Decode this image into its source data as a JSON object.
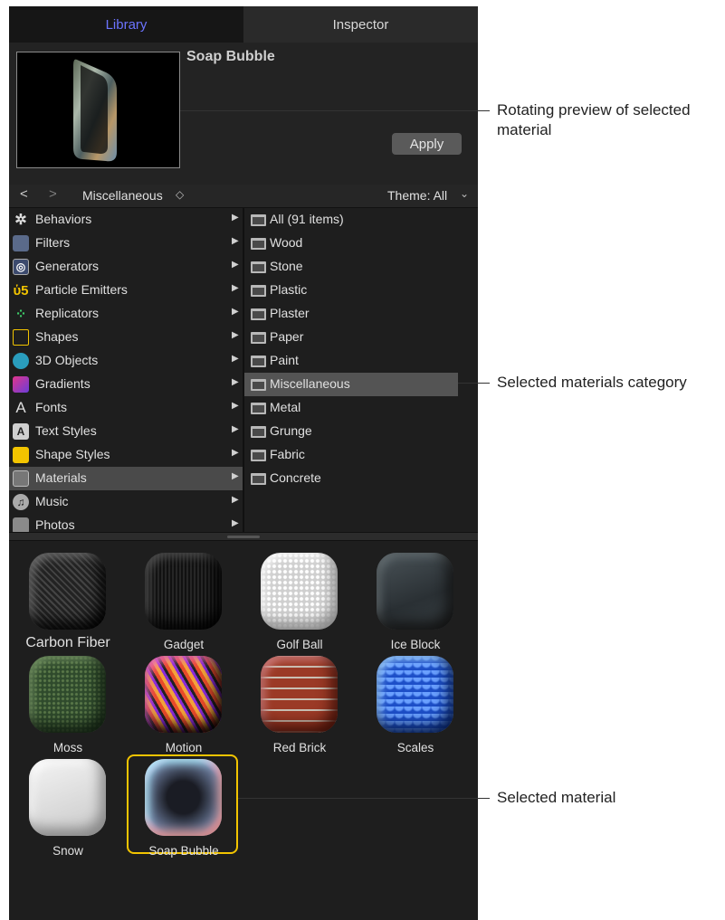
{
  "tabs": {
    "library": "Library",
    "inspector": "Inspector"
  },
  "preview": {
    "title": "Soap Bubble",
    "apply_label": "Apply"
  },
  "navbar": {
    "back": "<",
    "forward": ">",
    "path": "Miscellaneous",
    "path_arrows": "◇",
    "theme": "Theme: All",
    "theme_chevron": "⌄"
  },
  "categories": [
    {
      "label": "Behaviors",
      "icon": "gear-icon"
    },
    {
      "label": "Filters",
      "icon": "filmstrip-icon"
    },
    {
      "label": "Generators",
      "icon": "generator-icon"
    },
    {
      "label": "Particle Emitters",
      "icon": "particle-emitter-icon"
    },
    {
      "label": "Replicators",
      "icon": "replicator-icon"
    },
    {
      "label": "Shapes",
      "icon": "shape-icon"
    },
    {
      "label": "3D Objects",
      "icon": "cube-icon"
    },
    {
      "label": "Gradients",
      "icon": "gradient-icon"
    },
    {
      "label": "Fonts",
      "icon": "font-icon"
    },
    {
      "label": "Text Styles",
      "icon": "text-style-icon"
    },
    {
      "label": "Shape Styles",
      "icon": "shape-style-icon"
    },
    {
      "label": "Materials",
      "icon": "material-icon"
    },
    {
      "label": "Music",
      "icon": "music-icon"
    },
    {
      "label": "Photos",
      "icon": "photo-icon"
    }
  ],
  "selected_category": "Materials",
  "subcategories": [
    "All (91 items)",
    "Wood",
    "Stone",
    "Plastic",
    "Plaster",
    "Paper",
    "Paint",
    "Miscellaneous",
    "Metal",
    "Grunge",
    "Fabric",
    "Concrete"
  ],
  "selected_subcategory": "Miscellaneous",
  "materials": [
    "Carbon Fiber",
    "Gadget",
    "Golf Ball",
    "Ice Block",
    "Moss",
    "Motion",
    "Red Brick",
    "Scales",
    "Snow",
    "Soap Bubble"
  ],
  "selected_material": "Soap Bubble",
  "annotations": {
    "preview": "Rotating preview of selected material",
    "category": "Selected materials category",
    "material": "Selected material"
  },
  "colors": {
    "accent_tab": "#6c74ff",
    "selection_border": "#f2c400"
  }
}
